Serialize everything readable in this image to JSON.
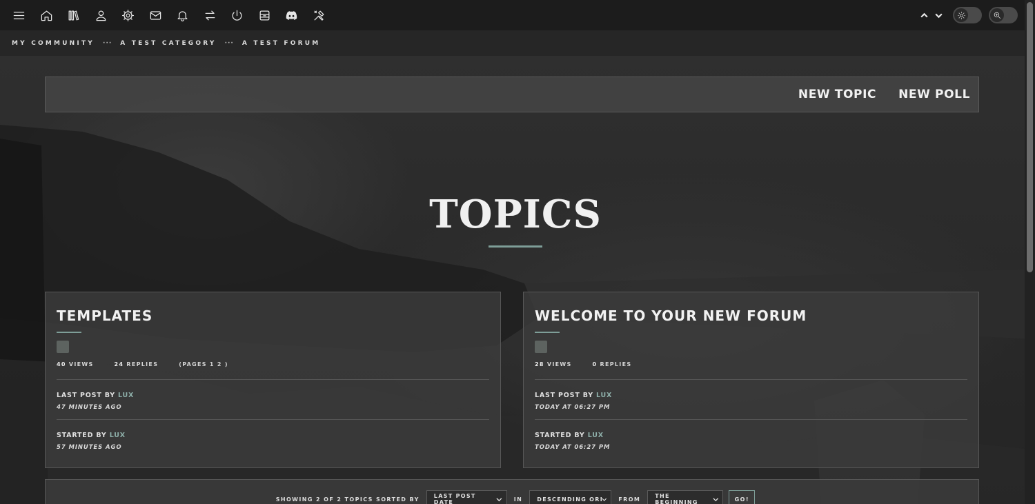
{
  "nav": {
    "icons": [
      "menu-icon",
      "home-icon",
      "library-icon",
      "user-icon",
      "gear-icon",
      "mail-icon",
      "bell-icon",
      "swap-icon",
      "power-icon",
      "archive-icon",
      "discord-icon",
      "tools-icon"
    ],
    "right_icons": [
      "chevron-up-icon",
      "chevron-down-icon",
      "theme-toggle",
      "zoom-toggle"
    ]
  },
  "breadcrumb": {
    "items": [
      "MY COMMUNITY",
      "A TEST CATEGORY",
      "A TEST FORUM"
    ],
    "separator": "···"
  },
  "actions": {
    "new_topic": "NEW TOPIC",
    "new_poll": "NEW POLL"
  },
  "heading": "TOPICS",
  "topics": [
    {
      "title": "TEMPLATES",
      "views_count": "40",
      "views_label": "VIEWS",
      "replies_count": "24",
      "replies_label": "REPLIES",
      "pages": "(PAGES 1 2 )",
      "last_post_label": "LAST POST BY",
      "last_post_user": "LUX",
      "last_post_time": "47 MINUTES AGO",
      "started_label": "STARTED BY",
      "started_user": "LUX",
      "started_time": "57 MINUTES AGO"
    },
    {
      "title": "WELCOME TO YOUR NEW FORUM",
      "views_count": "28",
      "views_label": "VIEWS",
      "replies_count": "0",
      "replies_label": "REPLIES",
      "last_post_label": "LAST POST BY",
      "last_post_user": "LUX",
      "last_post_time": "TODAY AT 06:27 PM",
      "started_label": "STARTED BY",
      "started_user": "LUX",
      "started_time": "TODAY AT 06:27 PM"
    }
  ],
  "sort": {
    "showing": "SHOWING 2 OF 2 TOPICS SORTED BY",
    "sort_by": "LAST POST DATE",
    "in_label": "IN",
    "order": "DESCENDING ORDER",
    "from_label": "FROM",
    "from": "THE BEGINNING",
    "go": "GO!"
  },
  "colors": {
    "accent": "#7e9e98",
    "username": "#8fb1ab",
    "topbar": "#1c1c1c"
  }
}
